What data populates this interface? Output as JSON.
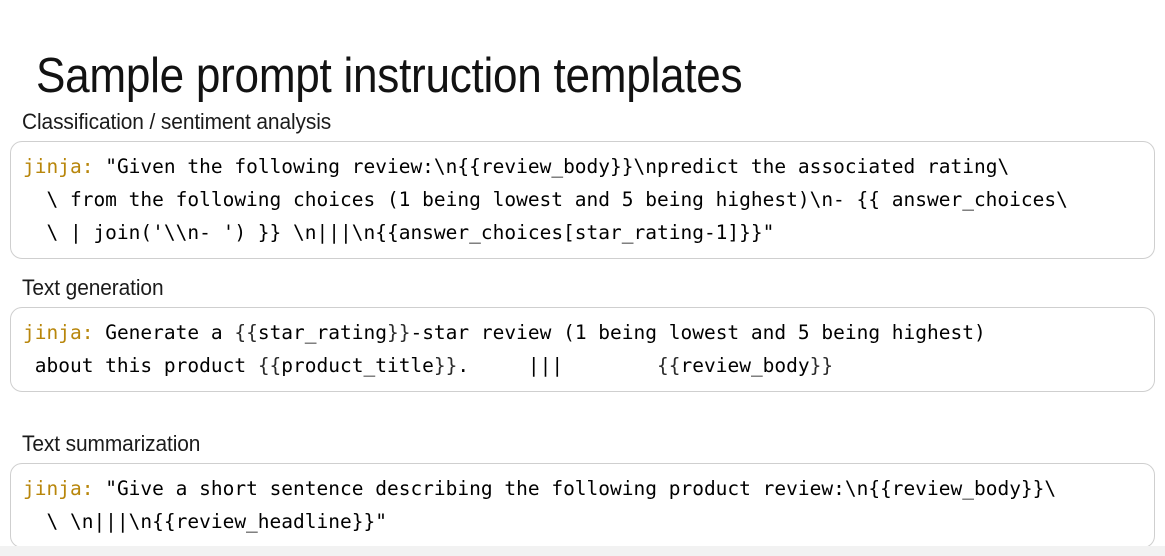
{
  "page": {
    "title": "Sample prompt instruction templates",
    "background_color": "#ffffff",
    "footer_strip_color": "#f2f2f2"
  },
  "colors": {
    "key": "#b8860b",
    "string": "#5aab60",
    "variable": "#a07f34",
    "plain": "#2b2b2b",
    "number": "#b8860b",
    "box_border": "#cfcfcf",
    "title_text": "#121212",
    "label_text": "#1b1b1b"
  },
  "sections": [
    {
      "label": "Classification / sentiment analysis",
      "code_lines": [
        [
          {
            "t": "jinja:",
            "c": "key"
          },
          {
            "t": " ",
            "c": "plain"
          },
          {
            "t": "\"Given the following review:\\n",
            "c": "string"
          },
          {
            "t": "{{review_body}}",
            "c": "variable"
          },
          {
            "t": "\\npredict the associated rating\\",
            "c": "string"
          }
        ],
        [
          {
            "t": "  \\ from the following choices (1 being lowest and 5 being highest)\\n- ",
            "c": "string"
          },
          {
            "t": "{{ answer_choices\\",
            "c": "variable"
          }
        ],
        [
          {
            "t": "  ",
            "c": "string"
          },
          {
            "t": "\\ | join('\\\\n- ') }}",
            "c": "variable"
          },
          {
            "t": " \\n|||\\n",
            "c": "string"
          },
          {
            "t": "{{answer_choices[star_rating-1]}}",
            "c": "variable"
          },
          {
            "t": "\"",
            "c": "string"
          }
        ]
      ]
    },
    {
      "label": "Text generation",
      "code_lines": [
        [
          {
            "t": "jinja:",
            "c": "key"
          },
          {
            "t": " ",
            "c": "plain"
          },
          {
            "t": "Generate a ",
            "c": "string"
          },
          {
            "t": "{{",
            "c": "plain"
          },
          {
            "t": "star_rating",
            "c": "string"
          },
          {
            "t": "}}",
            "c": "plain"
          },
          {
            "t": "-star review (1 being lowest and ",
            "c": "string"
          },
          {
            "t": "5",
            "c": "number"
          },
          {
            "t": " being highest)",
            "c": "string"
          }
        ],
        [
          {
            "t": " about this product ",
            "c": "string"
          },
          {
            "t": "{{",
            "c": "plain"
          },
          {
            "t": "product_title",
            "c": "string"
          },
          {
            "t": "}}",
            "c": "plain"
          },
          {
            "t": ".     ",
            "c": "string"
          },
          {
            "t": "|||",
            "c": "string"
          },
          {
            "t": "        ",
            "c": "string"
          },
          {
            "t": "{{",
            "c": "plain"
          },
          {
            "t": "review_body",
            "c": "string"
          },
          {
            "t": "}}",
            "c": "plain"
          }
        ]
      ]
    },
    {
      "label": "Text summarization",
      "code_lines": [
        [
          {
            "t": "jinja:",
            "c": "key"
          },
          {
            "t": " ",
            "c": "plain"
          },
          {
            "t": "\"Give a short sentence describing the following product review:\\n",
            "c": "string"
          },
          {
            "t": "{{review_body}}",
            "c": "variable"
          },
          {
            "t": "\\",
            "c": "string"
          }
        ],
        [
          {
            "t": "  \\ \\n|||\\n",
            "c": "string"
          },
          {
            "t": "{{review_headline}}",
            "c": "variable"
          },
          {
            "t": "\"",
            "c": "string"
          }
        ]
      ]
    }
  ]
}
